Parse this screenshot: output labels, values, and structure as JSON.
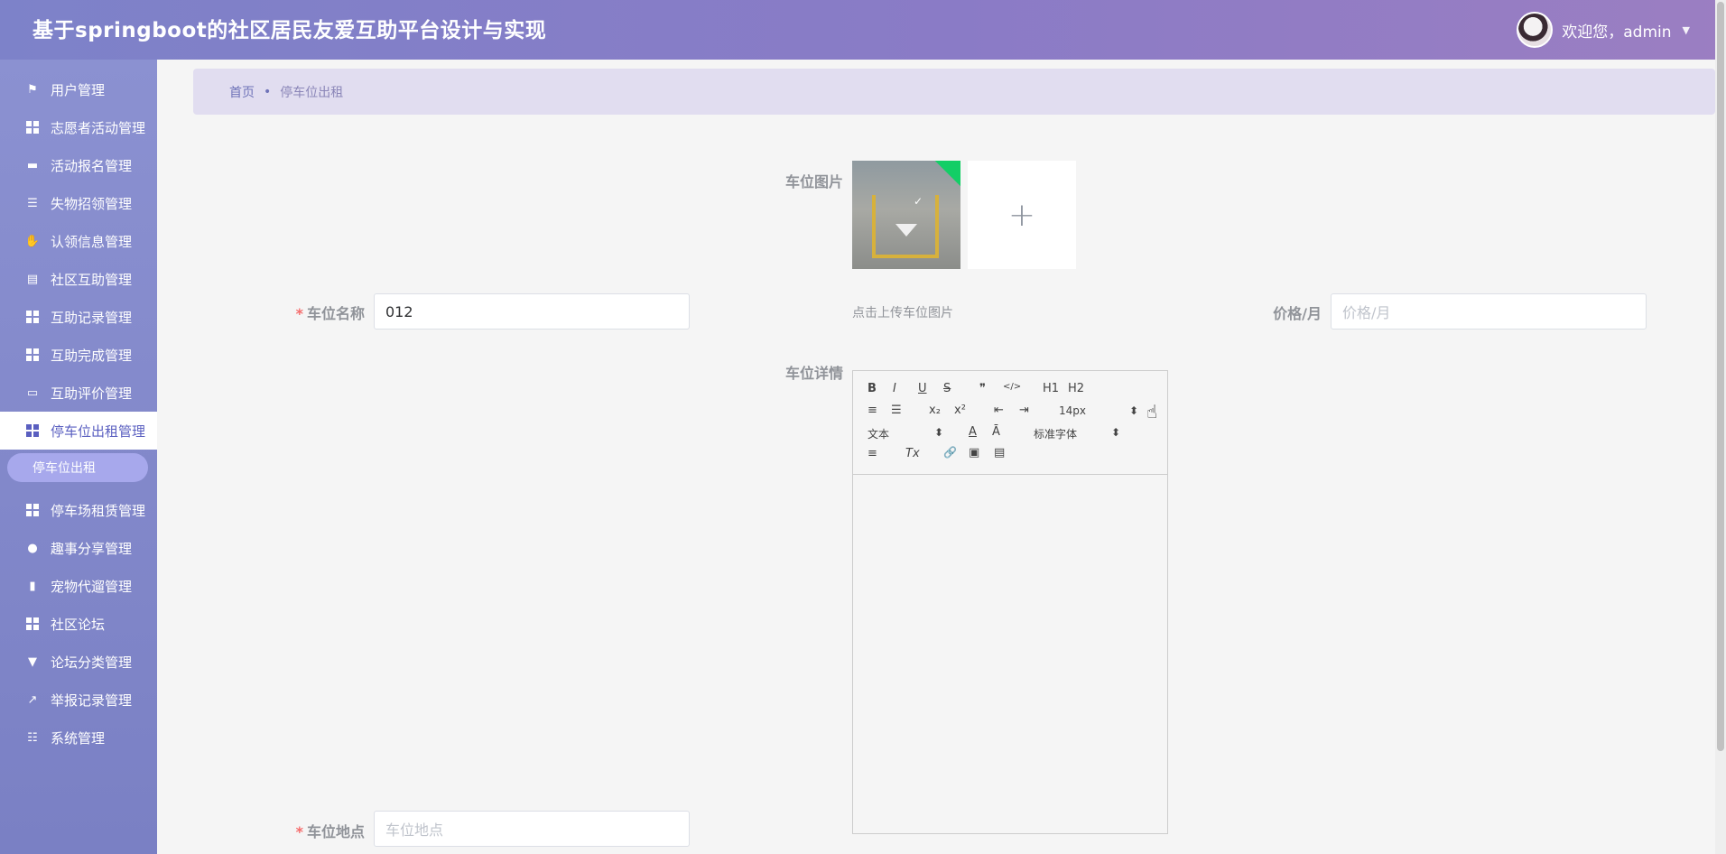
{
  "header": {
    "title": "基于springboot的社区居民友爱互助平台设计与实现",
    "welcome": "欢迎您，admin",
    "avatar_icon": "user-avatar"
  },
  "sidebar": {
    "items": [
      {
        "label": "用户管理",
        "icon": "flag-icon"
      },
      {
        "label": "志愿者活动管理",
        "icon": "grid-icon"
      },
      {
        "label": "活动报名管理",
        "icon": "briefcase-icon"
      },
      {
        "label": "失物招领管理",
        "icon": "list-icon"
      },
      {
        "label": "认领信息管理",
        "icon": "hand-icon"
      },
      {
        "label": "社区互助管理",
        "icon": "clipboard-icon"
      },
      {
        "label": "互助记录管理",
        "icon": "grid-icon"
      },
      {
        "label": "互助完成管理",
        "icon": "grid-icon"
      },
      {
        "label": "互助评价管理",
        "icon": "comment-icon"
      },
      {
        "label": "停车位出租管理",
        "icon": "grid-icon",
        "active": true
      },
      {
        "label": "停车场租赁管理",
        "icon": "grid-icon"
      },
      {
        "label": "趣事分享管理",
        "icon": "person-icon"
      },
      {
        "label": "宠物代遛管理",
        "icon": "bar-chart-icon"
      },
      {
        "label": "社区论坛",
        "icon": "grid-icon"
      },
      {
        "label": "论坛分类管理",
        "icon": "stamp-icon"
      },
      {
        "label": "举报记录管理",
        "icon": "trend-icon"
      },
      {
        "label": "系统管理",
        "icon": "sliders-icon"
      }
    ],
    "submenu_label": "停车位出租"
  },
  "breadcrumb": {
    "home": "首页",
    "separator": "•",
    "current": "停车位出租"
  },
  "form": {
    "image_label": "车位图片",
    "image_tip": "点击上传车位图片",
    "upload_plus": "+",
    "upload_check": "✓",
    "name_label": "车位名称",
    "name_value": "012",
    "price_label": "价格/月",
    "price_placeholder": "价格/月",
    "detail_label": "车位详情",
    "location_label": "车位地点",
    "location_placeholder": "车位地点",
    "required_mark": "*"
  },
  "editor": {
    "font_size": "14px",
    "header_select": "文本",
    "font_family": "标准字体",
    "buttons": {
      "bold": "B",
      "italic": "I",
      "underline": "U",
      "strike": "S",
      "quote": "❞",
      "code": "</>",
      "h1": "H1",
      "h2": "H2",
      "ordered": "≡",
      "bullet": "☰",
      "sub": "x₂",
      "sup": "x²",
      "outdent": "⇤",
      "indent": "⇥",
      "color": "A",
      "background": "Ā",
      "align": "≡",
      "clean": "Tx",
      "link": "🔗",
      "image": "▣",
      "video": "▤",
      "select_arrows": "⬍"
    }
  },
  "colors": {
    "header_start": "#7d82c9",
    "header_end": "#9b7ec2",
    "sidebar": "#8b91d1",
    "active_text": "#5a5fc0",
    "submenu": "#a7a8ec",
    "breadcrumb_bg": "#e1ddf0",
    "required": "#f56c6c"
  }
}
